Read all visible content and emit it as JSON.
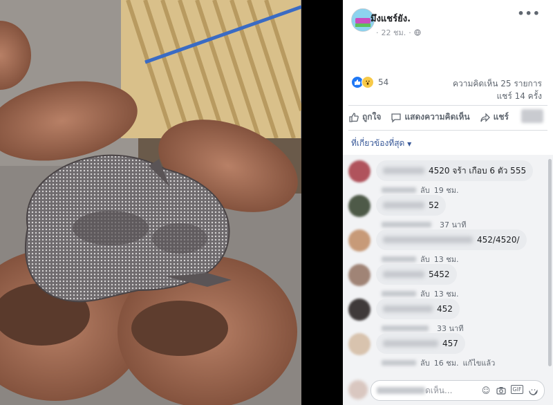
{
  "photo": {
    "alt_icon": "frog-photo"
  },
  "post": {
    "page_name": "มึงแชร์ยัง.",
    "time": "22 ชม.",
    "more_label": "•••",
    "reaction_count": "54",
    "comments_stat": "ความคิดเห็น 25 รายการ",
    "shares_stat": "แชร์ 14 ครั้ง"
  },
  "actions": {
    "like": "ถูกใจ",
    "comment": "แสดงความคิดเห็น",
    "share": "แชร์"
  },
  "filter": {
    "label": "ที่เกี่ยวข้องที่สุด"
  },
  "comments": [
    {
      "text": "4520 จร้า เกือบ 6 ตัว 555",
      "reply_prefix": "ลับ",
      "time": "19 ชม.",
      "edited": ""
    },
    {
      "text": "52",
      "reply_prefix": "",
      "time": "37 นาที",
      "edited": ""
    },
    {
      "text": "452/4520/",
      "reply_prefix": "ลับ",
      "time": "13 ชม.",
      "edited": ""
    },
    {
      "text": "5452",
      "reply_prefix": "ลับ",
      "time": "13 ชม.",
      "edited": ""
    },
    {
      "text": "452",
      "reply_prefix": "",
      "time": "33 นาที",
      "edited": ""
    },
    {
      "text": "457",
      "reply_prefix": "ลับ",
      "time": "16 ชม.",
      "edited": "แก้ไขแล้ว"
    }
  ],
  "reply": {
    "placeholder": "ดเห็น..."
  }
}
